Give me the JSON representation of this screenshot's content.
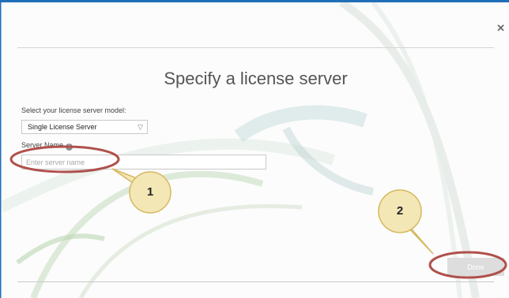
{
  "dialog": {
    "title": "Specify a license server",
    "close_icon": "close-icon"
  },
  "license_model": {
    "label": "Select your license server model:",
    "selected": "Single License Server"
  },
  "server_name": {
    "label": "Server Name",
    "placeholder": "Enter server name",
    "value": ""
  },
  "done_button": {
    "label": "Done"
  },
  "callouts": [
    {
      "number": "1"
    },
    {
      "number": "2"
    }
  ],
  "colors": {
    "frame": "#1f6fb8",
    "highlight": "#b0504c",
    "callout_fill": "#f4e7b6",
    "callout_stroke": "#d6b860"
  }
}
